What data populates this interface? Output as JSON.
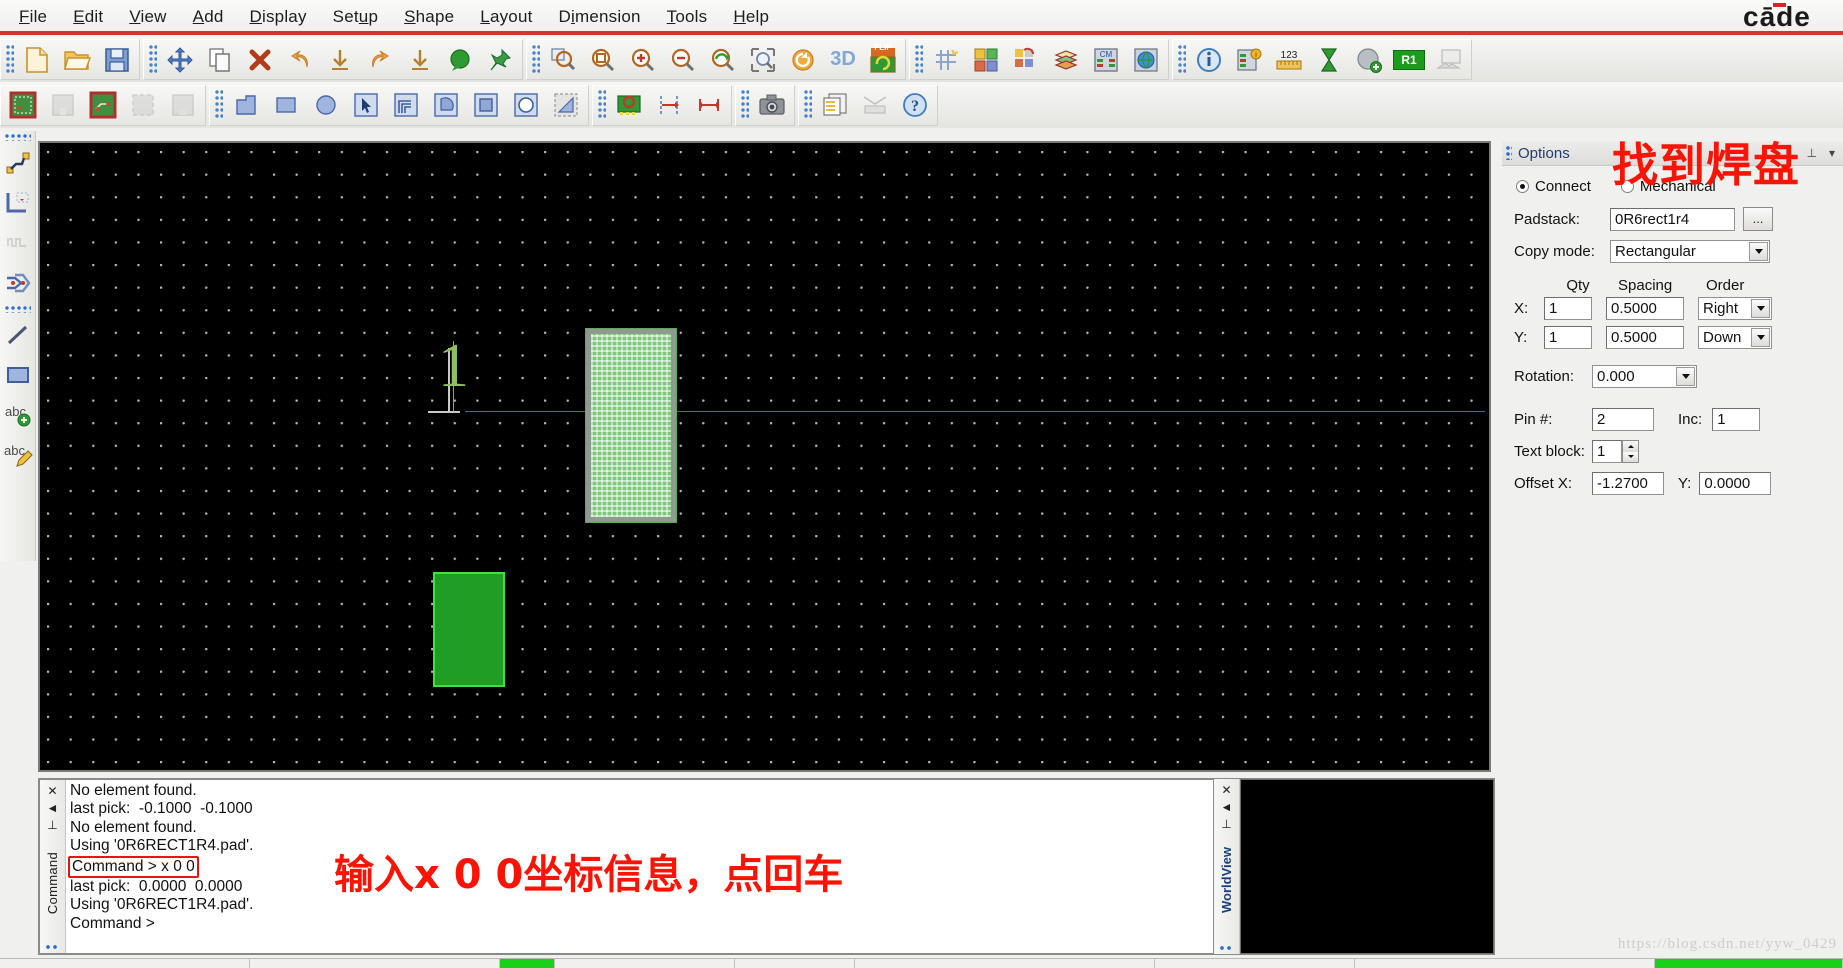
{
  "app": {
    "brand": "cāde",
    "watermark": "https://blog.csdn.net/yyw_0429"
  },
  "menubar": {
    "items": [
      {
        "id": "file",
        "label": "File",
        "mnemonic": "F"
      },
      {
        "id": "edit",
        "label": "Edit",
        "mnemonic": "E"
      },
      {
        "id": "view",
        "label": "View",
        "mnemonic": "V"
      },
      {
        "id": "add",
        "label": "Add",
        "mnemonic": "A"
      },
      {
        "id": "display",
        "label": "Display",
        "mnemonic": "D"
      },
      {
        "id": "setup",
        "label": "Setup",
        "mnemonic": "u"
      },
      {
        "id": "shape",
        "label": "Shape",
        "mnemonic": "S"
      },
      {
        "id": "layout",
        "label": "Layout",
        "mnemonic": "L"
      },
      {
        "id": "dimension",
        "label": "Dimension",
        "mnemonic": "i"
      },
      {
        "id": "tools",
        "label": "Tools",
        "mnemonic": "T"
      },
      {
        "id": "help",
        "label": "Help",
        "mnemonic": "H"
      }
    ]
  },
  "toolbar_row1": {
    "groups": [
      {
        "icons": [
          "new-file-icon",
          "open-folder-icon",
          "save-disk-icon"
        ]
      },
      {
        "icons": [
          "move-icon",
          "copy-icon",
          "delete-x-icon",
          "undo-icon",
          "undo-to-icon",
          "redo-icon",
          "redo-to-icon",
          "comment-balloon-icon",
          "pin-push-icon"
        ]
      },
      {
        "icons": [
          "zoom-fit-icon",
          "zoom-window-icon",
          "zoom-in-icon",
          "zoom-out-icon",
          "zoom-previous-icon",
          "zoom-selection-icon",
          "refresh-icon",
          "view-3d-icon",
          "flip-design-icon"
        ]
      },
      {
        "icons": [
          "grid-toggle-icon",
          "color-layers-icon",
          "color-palette-icon",
          "layer-stack-icon",
          "cm-table-icon",
          "globe-grid-icon"
        ]
      },
      {
        "icons": [
          "info-icon",
          "property-info-icon",
          "measure-ruler-icon",
          "hourglass-icon",
          "add-circle-icon",
          "r1-badge-icon",
          "screen-capture-icon"
        ]
      }
    ],
    "r1_badge_text": "R1",
    "flip_badge_text": "FLIP",
    "three_d_text": "3D",
    "measure_text": "123"
  },
  "toolbar_row2": {
    "groups": [
      {
        "icons": [
          "board-outline-icon",
          "board-blank-icon",
          "board-routed-icon",
          "board-dashed-icon",
          "board-empty-icon"
        ]
      },
      {
        "icons": [
          "shape-lshape-icon",
          "shape-rect-icon",
          "shape-circle-icon",
          "select-arrow-icon",
          "shape-path-icon",
          "shape-arc-icon",
          "shape-square-icon",
          "shape-oval-icon",
          "shape-polygon-icon"
        ]
      },
      {
        "icons": [
          "package-pin-icon",
          "dim-linear-icon",
          "dim-width-icon"
        ]
      },
      {
        "icons": [
          "camera-icon"
        ]
      },
      {
        "icons": [
          "report-icon",
          "plot-icon",
          "help-question-icon"
        ]
      }
    ]
  },
  "left_toolbar": {
    "groups": [
      {
        "icons": [
          "route-connect-icon",
          "route-corner-icon",
          "route-delay-icon",
          "route-bus-icon"
        ]
      },
      {
        "icons": [
          "draw-line-icon",
          "draw-rectangle-icon",
          "add-text-icon",
          "edit-text-icon"
        ]
      }
    ]
  },
  "canvas": {
    "pin_label": "1",
    "background_color": "#000000",
    "grid_dot_color": "#b9b9b9",
    "pad_fill_color": "#7ec87e",
    "pad_border_color": "#8f9b8f",
    "solid_shape_color": "#1f9d25",
    "solid_shape_border": "#3ee33e",
    "crosshair_color": "#4f7a3e"
  },
  "options": {
    "title": "Options",
    "pin_icon": "pin-icon",
    "chevron_icon": "chevron-down-icon",
    "annotation": "找到焊盘",
    "annotation_color": "#fb1405",
    "type_radio": {
      "connect_label": "Connect",
      "mechanical_label": "Mechanical",
      "selected": "Connect"
    },
    "padstack": {
      "label": "Padstack:",
      "value": "0R6rect1r4",
      "browse_label": "..."
    },
    "copy_mode": {
      "label": "Copy mode:",
      "value": "Rectangular"
    },
    "grid_headers": {
      "qty": "Qty",
      "spacing": "Spacing",
      "order": "Order"
    },
    "axis_rows": [
      {
        "axis": "X:",
        "qty": "1",
        "spacing": "0.5000",
        "order": "Right"
      },
      {
        "axis": "Y:",
        "qty": "1",
        "spacing": "0.5000",
        "order": "Down"
      }
    ],
    "rotation": {
      "label": "Rotation:",
      "value": "0.000"
    },
    "pin_number": {
      "label": "Pin #:",
      "value": "2"
    },
    "increment": {
      "label": "Inc:",
      "value": "1"
    },
    "text_block": {
      "label": "Text block:",
      "value": "1"
    },
    "offset": {
      "label_x": "Offset X:",
      "value_x": "-1.2700",
      "label_y": "Y:",
      "value_y": "0.0000"
    }
  },
  "command_panel": {
    "vertical_label": "Command",
    "close_icon": "close-icon",
    "collapse_icon": "collapse-left-icon",
    "pin_icon": "pin-icon",
    "lines": [
      {
        "text": "No element found.",
        "highlighted": false
      },
      {
        "text": "last pick:  -0.1000  -0.1000",
        "highlighted": false
      },
      {
        "text": "No element found.",
        "highlighted": false
      },
      {
        "text": "Using '0R6RECT1R4.pad'.",
        "highlighted": false
      },
      {
        "text": "Command > x 0 0",
        "highlighted": true
      },
      {
        "text": "last pick:  0.0000  0.0000",
        "highlighted": false
      },
      {
        "text": "Using '0R6RECT1R4.pad'.",
        "highlighted": false
      },
      {
        "text": "Command >",
        "highlighted": false
      }
    ],
    "annotation": "输入x 0 0坐标信息，点回车",
    "annotation_color": "#fb1405",
    "scroll_up_icon": "scroll-up-icon",
    "scroll_down_icon": "scroll-down-icon"
  },
  "worldview": {
    "vertical_label": "WorldView",
    "close_icon": "close-icon",
    "collapse_icon": "collapse-left-icon",
    "pin_icon": "pin-icon"
  }
}
